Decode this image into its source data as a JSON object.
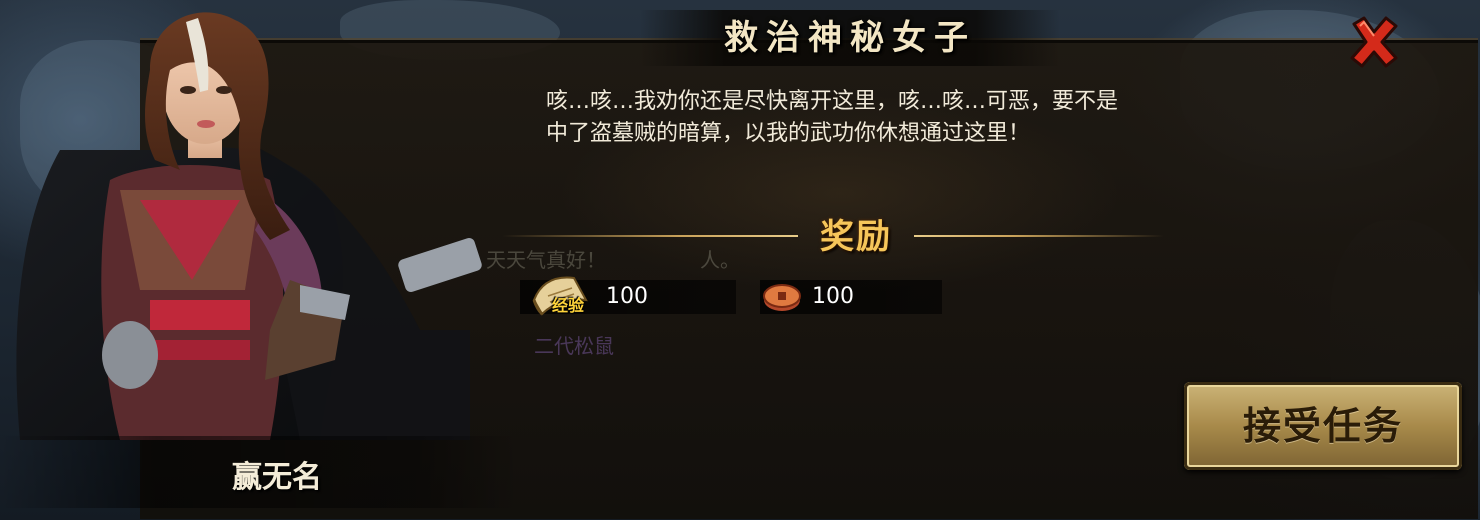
{
  "dialog": {
    "title": "救治神秘女子",
    "text_lines": [
      "咳…咳…我劝你还是尽快离开这里，咳…咳…可恶，要不是",
      "中了盗墓贼的暗算，以我的武功你休想通过这里！"
    ],
    "npc_name": "赢无名"
  },
  "rewards": {
    "heading": "奖励",
    "items": [
      {
        "icon": "scroll-icon",
        "tag": "经验",
        "value": "100"
      },
      {
        "icon": "coin-icon",
        "tag": "",
        "value": "100"
      }
    ]
  },
  "buttons": {
    "accept_label": "接受任务",
    "close_icon": "close-x-icon"
  },
  "background_text": {
    "line1": "天天气真好！",
    "line2": "人。",
    "line3": "二代松鼠"
  },
  "colors": {
    "title": "#f3e6c4",
    "reward_heading": "#f6c65a",
    "close_x": "#d42a1a",
    "button_gold": "#b89a58"
  }
}
